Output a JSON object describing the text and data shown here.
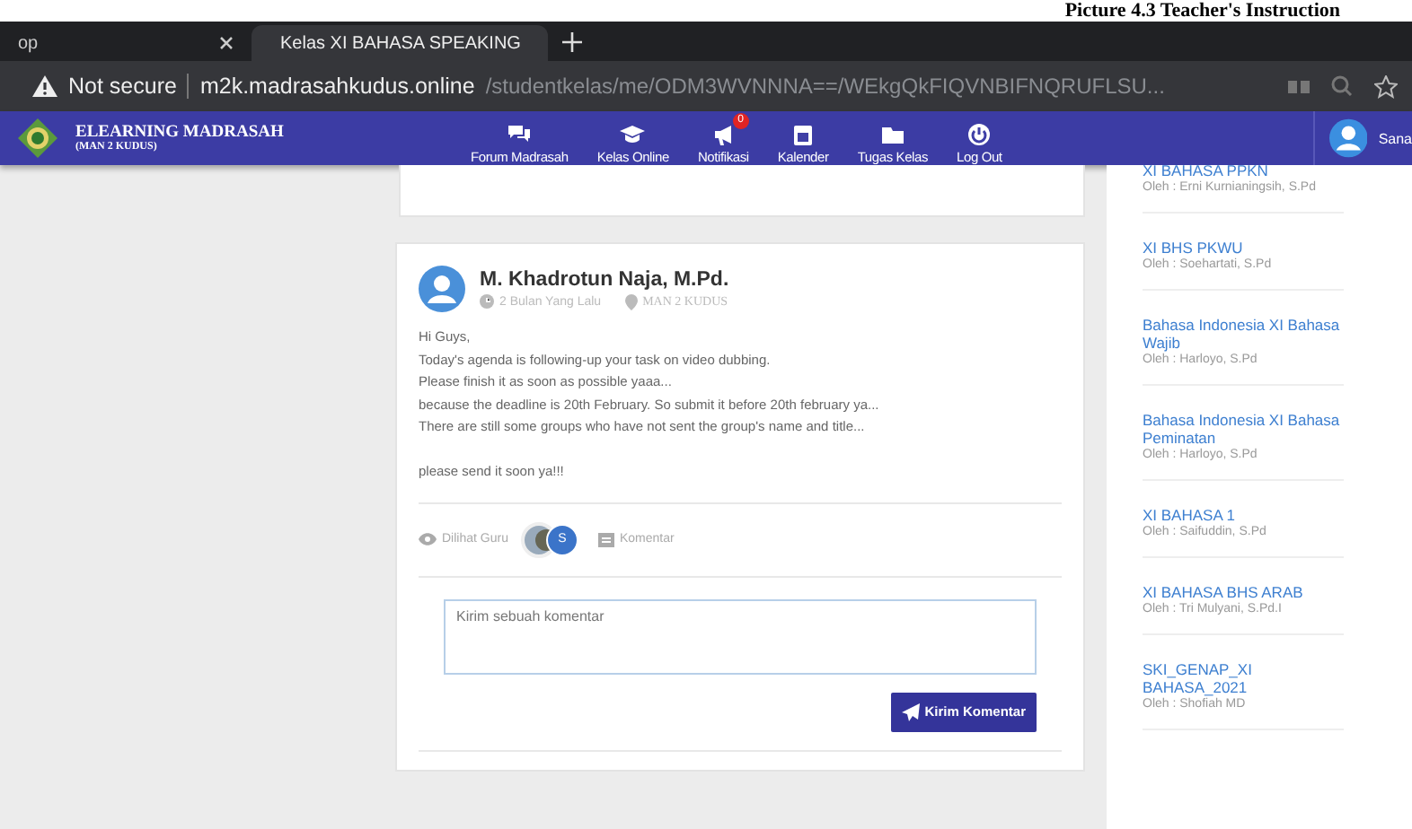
{
  "caption": "Picture 4.3 Teacher's Instruction",
  "browser": {
    "tabs": [
      {
        "label": "op",
        "selected": false
      },
      {
        "label": "Kelas XI BAHASA SPEAKING",
        "selected": true
      }
    ],
    "address": {
      "security": "Not secure",
      "host": "m2k.madrasahkudus.online",
      "path": "/studentkelas/me/ODM3WVNNNA==/WEkgQkFIQVNBIFNQRUFLSU..."
    }
  },
  "header": {
    "brand": "ELEARNING MADRASAH",
    "subtitle": "(MAN 2 KUDUS)",
    "nav": [
      {
        "label": "Forum Madrasah",
        "kind": "chat"
      },
      {
        "label": "Kelas Online",
        "kind": "cap"
      },
      {
        "label": "Notifikasi",
        "kind": "megaphone",
        "badge": "0"
      },
      {
        "label": "Kalender",
        "kind": "calendar"
      },
      {
        "label": "Tugas Kelas",
        "kind": "folder"
      },
      {
        "label": "Log Out",
        "kind": "power"
      }
    ],
    "user": "Sana"
  },
  "post": {
    "author": "M. Khadrotun Naja, M.Pd.",
    "time": "2 Bulan Yang Lalu",
    "place": "MAN 2 KUDUS",
    "paragraphs": [
      [
        "Hi Guys,",
        "Today's agenda is following-up your task on video dubbing.",
        "Please finish it as soon as possible yaaa...",
        "because the deadline is 20th February. So submit it before 20th february ya...",
        "There are still some groups who have not sent the group's name and title..."
      ],
      [
        "please send it soon ya!!!"
      ]
    ],
    "seen": "Dilihat Guru",
    "viewer_initial": "S",
    "comments": "Komentar",
    "comment_placeholder": "Kirim sebuah komentar",
    "send": "Kirim Komentar"
  },
  "sidebar": {
    "items": [
      {
        "title": "XI BAHASA PPKN",
        "teacher": "Oleh : Erni Kurnianingsih, S.Pd"
      },
      {
        "title": "XI BHS PKWU",
        "teacher": "Oleh : Soehartati, S.Pd"
      },
      {
        "title": "Bahasa Indonesia XI Bahasa Wajib",
        "teacher": "Oleh : Harloyo, S.Pd"
      },
      {
        "title": "Bahasa Indonesia XI Bahasa Peminatan",
        "teacher": "Oleh : Harloyo, S.Pd"
      },
      {
        "title": "XI BAHASA 1",
        "teacher": "Oleh : Saifuddin, S.Pd"
      },
      {
        "title": "XI BAHASA BHS ARAB",
        "teacher": "Oleh : Tri Mulyani, S.Pd.I"
      },
      {
        "title": "SKI_GENAP_XI BAHASA_2021",
        "teacher": "Oleh : Shofiah MD"
      }
    ]
  }
}
